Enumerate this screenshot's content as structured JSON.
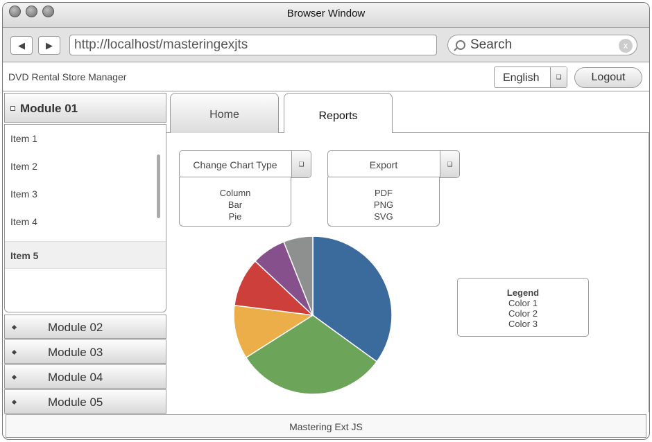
{
  "window": {
    "title": "Browser Window"
  },
  "addressbar": {
    "back_glyph": "◀",
    "forward_glyph": "▶",
    "url": "http://localhost/masteringexjts",
    "search_placeholder": "Search",
    "clear_glyph": "x"
  },
  "app": {
    "title": "DVD Rental Store Manager",
    "language": "English",
    "logout_label": "Logout"
  },
  "sidebar": {
    "active_module": "Module 01",
    "items": [
      "Item 1",
      "Item 2",
      "Item 3",
      "Item 4",
      "Item 5"
    ],
    "selected_item": "Item 5",
    "modules": [
      "Module 02",
      "Module 03",
      "Module 04",
      "Module 05"
    ]
  },
  "tabs": [
    {
      "label": "Home",
      "active": false
    },
    {
      "label": "Reports",
      "active": true
    }
  ],
  "toolbar": {
    "chart_type": {
      "label": "Change Chart Type",
      "options": [
        "Column",
        "Bar",
        "Pie"
      ]
    },
    "export": {
      "label": "Export",
      "options": [
        "PDF",
        "PNG",
        "SVG"
      ]
    }
  },
  "chart_data": {
    "type": "pie",
    "slices": [
      {
        "value": 35,
        "color": "#3b6a9d"
      },
      {
        "value": 31,
        "color": "#6ca45a"
      },
      {
        "value": 11,
        "color": "#ebae48"
      },
      {
        "value": 10,
        "color": "#cd3f3b"
      },
      {
        "value": 7,
        "color": "#86508c"
      },
      {
        "value": 6,
        "color": "#8e908f"
      }
    ]
  },
  "legend": {
    "title": "Legend",
    "items": [
      "Color 1",
      "Color 2",
      "Color 3"
    ]
  },
  "footer": {
    "text": "Mastering Ext JS"
  },
  "icons": {
    "dropdown_glyph": "❏"
  }
}
